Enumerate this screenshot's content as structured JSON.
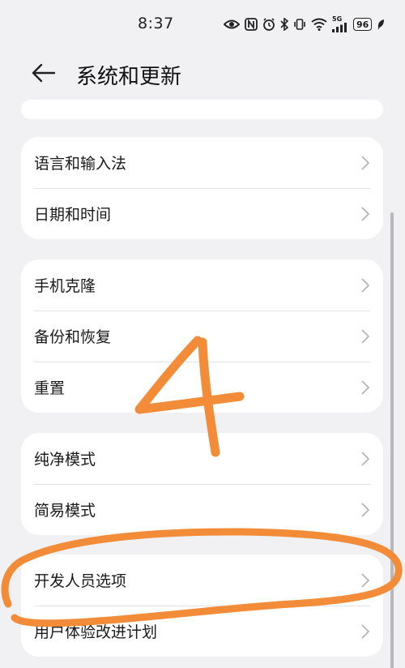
{
  "status_bar": {
    "time": "8:37",
    "network_label": "5G",
    "battery": "96",
    "icons": [
      "eye-icon",
      "nfc-icon",
      "alarm-icon",
      "bluetooth-icon",
      "vibrate-icon",
      "wifi-icon",
      "signal-icon",
      "battery-icon",
      "leaf-icon"
    ]
  },
  "header": {
    "title": "系统和更新",
    "back_icon": "arrow-left-icon"
  },
  "groups": [
    {
      "items": [
        {
          "label": "语言和输入法"
        },
        {
          "label": "日期和时间"
        }
      ]
    },
    {
      "items": [
        {
          "label": "手机克隆"
        },
        {
          "label": "备份和恢复"
        },
        {
          "label": "重置"
        }
      ]
    },
    {
      "items": [
        {
          "label": "纯净模式"
        },
        {
          "label": "简易模式"
        }
      ]
    },
    {
      "items": [
        {
          "label": "开发人员选项"
        },
        {
          "label": "用户体验改进计划"
        }
      ]
    }
  ],
  "annotation": {
    "number": "4",
    "color": "#f28c38",
    "highlight_target": "开发人员选项"
  },
  "colors": {
    "background": "#f1f1f3",
    "card": "#ffffff",
    "chevron": "#b5b5ba"
  }
}
